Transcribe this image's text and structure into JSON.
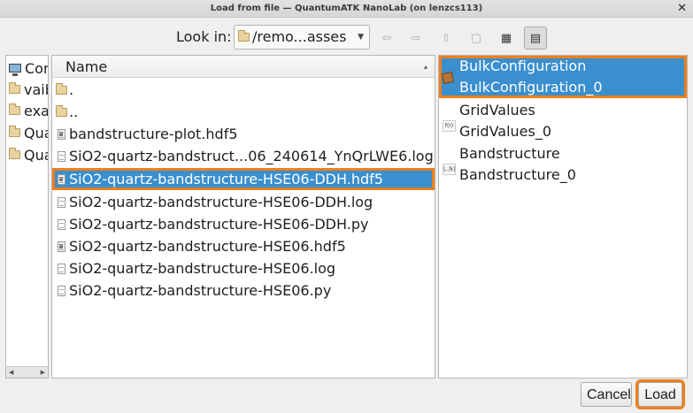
{
  "window": {
    "title": "Load from file — QuantumATK NanoLab (on lenzcs113)",
    "close_glyph": "✕"
  },
  "toolbar": {
    "look_in_label": "Look in:",
    "path": "/remo...asses",
    "buttons": [
      {
        "name": "back",
        "glyph": "⇦"
      },
      {
        "name": "forward",
        "glyph": "⇨"
      },
      {
        "name": "parent",
        "glyph": "⇧"
      },
      {
        "name": "new-folder",
        "glyph": "▢"
      },
      {
        "name": "list-view",
        "glyph": "▦"
      },
      {
        "name": "detail-view",
        "glyph": "▤"
      }
    ]
  },
  "sidebar": {
    "items": [
      {
        "label": "Computer",
        "icon": "computer-icon"
      },
      {
        "label": "vaibhav",
        "icon": "folder-icon"
      },
      {
        "label": "examples",
        "icon": "folder-icon"
      },
      {
        "label": "QuantumATK",
        "icon": "folder-icon"
      },
      {
        "label": "QuantumATK",
        "icon": "folder-icon"
      }
    ]
  },
  "file_list": {
    "column_header": "Name",
    "items": [
      {
        "name": ".",
        "type": "folder"
      },
      {
        "name": "..",
        "type": "folder"
      },
      {
        "name": "bandstructure-plot.hdf5",
        "type": "hdf5"
      },
      {
        "name": "SiO2-quartz-bandstruct...06_240614_YnQrLWE6.log",
        "type": "file"
      },
      {
        "name": "SiO2-quartz-bandstructure-HSE06-DDH.hdf5",
        "type": "hdf5",
        "selected": true
      },
      {
        "name": "SiO2-quartz-bandstructure-HSE06-DDH.log",
        "type": "file"
      },
      {
        "name": "SiO2-quartz-bandstructure-HSE06-DDH.py",
        "type": "file"
      },
      {
        "name": "SiO2-quartz-bandstructure-HSE06.hdf5",
        "type": "hdf5"
      },
      {
        "name": "SiO2-quartz-bandstructure-HSE06.log",
        "type": "file"
      },
      {
        "name": "SiO2-quartz-bandstructure-HSE06.py",
        "type": "file"
      }
    ]
  },
  "objects": {
    "items": [
      {
        "type": "BulkConfiguration",
        "id": "BulkConfiguration_0",
        "icon": "bulk-icon",
        "selected": true
      },
      {
        "type": "GridValues",
        "id": "GridValues_0",
        "icon": "fx-icon",
        "icon_text": "f(r)"
      },
      {
        "type": "Bandstructure",
        "id": "Bandstructure_0",
        "icon": "fx-icon",
        "icon_text": "|,.|k|"
      }
    ]
  },
  "buttons": {
    "cancel": "Cancel",
    "load": "Load"
  },
  "colors": {
    "selection": "#3a8fcf",
    "highlight": "#ef7f1a"
  }
}
